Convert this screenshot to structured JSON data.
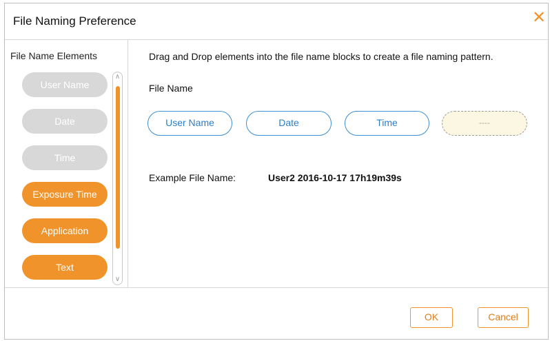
{
  "dialog": {
    "title": "File Naming Preference",
    "close_icon": "close-icon"
  },
  "colors": {
    "accent": "#f0932b",
    "link_blue": "#3a8ed6",
    "disabled_gray": "#d8d8d8"
  },
  "left_panel": {
    "header": "File Name Elements",
    "elements": [
      {
        "label": "User Name",
        "state": "disabled"
      },
      {
        "label": "Date",
        "state": "disabled"
      },
      {
        "label": "Time",
        "state": "disabled"
      },
      {
        "label": "Exposure Time",
        "state": "active"
      },
      {
        "label": "Application",
        "state": "active"
      },
      {
        "label": "Text",
        "state": "active"
      }
    ]
  },
  "right_panel": {
    "instruction": "Drag and Drop elements into the file name blocks to create a file naming pattern.",
    "file_name_label": "File Name",
    "blocks": [
      {
        "label": "User Name",
        "filled": true
      },
      {
        "label": "Date",
        "filled": true
      },
      {
        "label": "Time",
        "filled": true
      },
      {
        "label": "----",
        "filled": false
      }
    ],
    "example_label": "Example File Name:",
    "example_value": "User2 2016-10-17 17h19m39s"
  },
  "footer": {
    "ok_label": "OK",
    "cancel_label": "Cancel"
  }
}
